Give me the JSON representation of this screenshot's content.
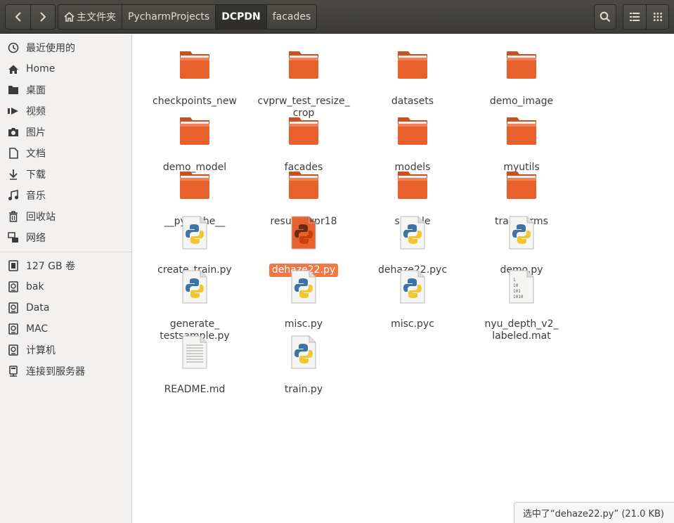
{
  "header": {
    "back_icon": "chevron-left-icon",
    "forward_icon": "chevron-right-icon",
    "breadcrumbs": [
      {
        "label": "主文件夹",
        "icon": "home-icon"
      },
      {
        "label": "PycharmProjects"
      },
      {
        "label": "DCPDN",
        "active": true
      },
      {
        "label": "facades"
      }
    ],
    "search_icon": "search-icon",
    "list_view_icon": "list-view-icon",
    "grid_view_icon": "grid-view-icon"
  },
  "sidebar": {
    "items": [
      {
        "label": "最近使用的",
        "icon": "clock-icon"
      },
      {
        "label": "Home",
        "icon": "home-icon"
      },
      {
        "label": "桌面",
        "icon": "folder-icon"
      },
      {
        "label": "视频",
        "icon": "video-icon"
      },
      {
        "label": "图片",
        "icon": "camera-icon"
      },
      {
        "label": "文档",
        "icon": "document-icon"
      },
      {
        "label": "下载",
        "icon": "download-icon"
      },
      {
        "label": "音乐",
        "icon": "music-icon"
      },
      {
        "label": "回收站",
        "icon": "trash-icon"
      },
      {
        "label": "网络",
        "icon": "network-icon"
      }
    ],
    "devices": [
      {
        "label": "127 GB 卷",
        "icon": "chip-icon"
      },
      {
        "label": "bak",
        "icon": "drive-icon"
      },
      {
        "label": "Data",
        "icon": "drive-icon"
      },
      {
        "label": "MAC",
        "icon": "drive-icon"
      },
      {
        "label": "计算机",
        "icon": "drive-icon"
      },
      {
        "label": "连接到服务器",
        "icon": "server-icon"
      }
    ]
  },
  "files": [
    {
      "name": "checkpoints_new",
      "type": "folder"
    },
    {
      "name": "cvprw_test_resize_\ncrop",
      "type": "folder"
    },
    {
      "name": "datasets",
      "type": "folder"
    },
    {
      "name": "demo_image",
      "type": "folder"
    },
    {
      "name": "demo_model",
      "type": "folder"
    },
    {
      "name": "facades",
      "type": "folder"
    },
    {
      "name": "models",
      "type": "folder"
    },
    {
      "name": "myutils",
      "type": "folder"
    },
    {
      "name": "__pycache__",
      "type": "folder"
    },
    {
      "name": "result_cvpr18",
      "type": "folder"
    },
    {
      "name": "sample",
      "type": "folder"
    },
    {
      "name": "transforms",
      "type": "folder"
    },
    {
      "name": "create_train.py",
      "type": "python"
    },
    {
      "name": "dehaze22.py",
      "type": "python-selected",
      "selected": true
    },
    {
      "name": "dehaze22.pyc",
      "type": "python"
    },
    {
      "name": "demo.py",
      "type": "python"
    },
    {
      "name": "generate_\ntestsample.py",
      "type": "python"
    },
    {
      "name": "misc.py",
      "type": "python"
    },
    {
      "name": "misc.pyc",
      "type": "python"
    },
    {
      "name": "nyu_depth_v2_\nlabeled.mat",
      "type": "binary"
    },
    {
      "name": "README.md",
      "type": "text"
    },
    {
      "name": "train.py",
      "type": "python"
    }
  ],
  "status": {
    "text": "选中了“dehaze22.py” (21.0 KB)"
  },
  "colors": {
    "folder": "#e8602c",
    "selection": "#f07746",
    "header": "#3c3b37"
  }
}
